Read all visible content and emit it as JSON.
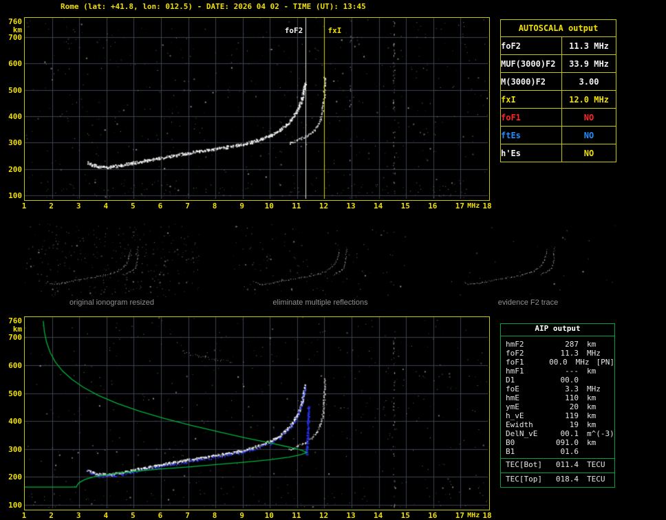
{
  "title": "Rome (lat: +41.8, lon: 012.5) - DATE: 2026 04 02 - TIME (UT): 13:45",
  "colors": {
    "yellow": "#f0e000",
    "white": "#f2f2f2",
    "red": "#ff2626",
    "blue": "#1e8fff",
    "green": "#00b43c",
    "grid": "#3d4450",
    "frame": "#c9c900",
    "caption": "#909090",
    "trace_blue": "#2a35ff"
  },
  "top_plot": {
    "y_unit": "km",
    "x_unit": "MHz",
    "y_ticks": [
      760,
      700,
      600,
      500,
      400,
      300,
      200,
      100
    ],
    "x_ticks": [
      1,
      2,
      3,
      4,
      5,
      6,
      7,
      8,
      9,
      10,
      11,
      12,
      13,
      14,
      15,
      16,
      17,
      18
    ],
    "markers": [
      {
        "label": "foF2",
        "freq": 11.3,
        "color": "white"
      },
      {
        "label": "fxI",
        "freq": 12.0,
        "color": "yellow"
      }
    ]
  },
  "bottom_plot": {
    "y_unit": "km",
    "x_unit": "MHz",
    "y_ticks": [
      760,
      700,
      600,
      500,
      400,
      300,
      200,
      100
    ],
    "x_ticks": [
      1,
      2,
      3,
      4,
      5,
      6,
      7,
      8,
      9,
      10,
      11,
      12,
      13,
      14,
      15,
      16,
      17,
      18
    ]
  },
  "autoscala": {
    "title": "AUTOSCALA output",
    "rows": [
      {
        "label": "foF2",
        "value": "11.3 MHz",
        "label_color": "white",
        "value_color": "white"
      },
      {
        "label": "MUF(3000)F2",
        "value": "33.9 MHz",
        "label_color": "white",
        "value_color": "white"
      },
      {
        "label": "M(3000)F2",
        "value": "3.00",
        "label_color": "white",
        "value_color": "white"
      },
      {
        "label": "fxI",
        "value": "12.0 MHz",
        "label_color": "yellow",
        "value_color": "yellow"
      },
      {
        "label": "foF1",
        "value": "NO",
        "label_color": "red",
        "value_color": "red"
      },
      {
        "label": "ftEs",
        "value": "NO",
        "label_color": "blue",
        "value_color": "blue"
      },
      {
        "label": "h'Es",
        "value": "NO",
        "label_color": "white",
        "value_color": "yellow"
      }
    ]
  },
  "thumbnails": [
    {
      "caption": "original ionogram resized"
    },
    {
      "caption": "eliminate multiple reflections"
    },
    {
      "caption": "evidence F2 trace"
    }
  ],
  "aip": {
    "title": "AIP output",
    "rows": [
      {
        "label": "hmF2",
        "value": "287",
        "unit": "km",
        "extra": ""
      },
      {
        "label": "foF2",
        "value": "11.3",
        "unit": "MHz",
        "extra": ""
      },
      {
        "label": "foF1",
        "value": "00.0",
        "unit": "MHz",
        "extra": "[PN]"
      },
      {
        "label": "hmF1",
        "value": "---",
        "unit": "km",
        "extra": ""
      },
      {
        "label": "D1",
        "value": "00.0",
        "unit": "",
        "extra": ""
      },
      {
        "label": "foE",
        "value": "3.3",
        "unit": "MHz",
        "extra": ""
      },
      {
        "label": "hmE",
        "value": "110",
        "unit": "km",
        "extra": ""
      },
      {
        "label": "ymE",
        "value": "20",
        "unit": "km",
        "extra": ""
      },
      {
        "label": "h_vE",
        "value": "119",
        "unit": "km",
        "extra": ""
      },
      {
        "label": "Ewidth",
        "value": "19",
        "unit": "km",
        "extra": ""
      },
      {
        "label": "DelN_vE",
        "value": "00.1",
        "unit": "m^(-3)",
        "extra": ""
      },
      {
        "label": "B0",
        "value": "091.0",
        "unit": "km",
        "extra": ""
      },
      {
        "label": "B1",
        "value": "01.6",
        "unit": "",
        "extra": ""
      }
    ],
    "tec_rows": [
      {
        "label": "TEC[Bot]",
        "value": "011.4",
        "unit": "TECU"
      },
      {
        "label": "TEC[Top]",
        "value": "018.4",
        "unit": "TECU"
      }
    ]
  },
  "chart_data": [
    {
      "type": "scatter",
      "title": "autoscaled ionogram (virtual height vs frequency)",
      "xlabel": "MHz",
      "ylabel": "km",
      "xlim": [
        1,
        18
      ],
      "ylim": [
        88,
        772
      ],
      "grid": true,
      "foF2_mhz": 11.3,
      "fxI_mhz": 12.0,
      "f2_o_trace": [
        [
          3.3,
          228
        ],
        [
          3.45,
          219
        ],
        [
          3.65,
          213
        ],
        [
          3.9,
          211
        ],
        [
          4.2,
          213
        ],
        [
          4.55,
          218
        ],
        [
          4.95,
          226
        ],
        [
          5.4,
          235
        ],
        [
          5.9,
          244
        ],
        [
          6.4,
          253
        ],
        [
          6.9,
          262
        ],
        [
          7.4,
          270
        ],
        [
          7.9,
          278
        ],
        [
          8.4,
          286
        ],
        [
          8.9,
          295
        ],
        [
          9.3,
          305
        ],
        [
          9.7,
          318
        ],
        [
          10.05,
          332
        ],
        [
          10.35,
          350
        ],
        [
          10.6,
          370
        ],
        [
          10.8,
          392
        ],
        [
          10.95,
          416
        ],
        [
          11.07,
          442
        ],
        [
          11.16,
          470
        ],
        [
          11.23,
          500
        ],
        [
          11.28,
          530
        ]
      ],
      "f2_x_trace": [
        [
          10.7,
          300
        ],
        [
          11.0,
          312
        ],
        [
          11.3,
          326
        ],
        [
          11.55,
          343
        ],
        [
          11.72,
          364
        ],
        [
          11.84,
          390
        ],
        [
          11.91,
          420
        ],
        [
          11.95,
          452
        ],
        [
          11.98,
          485
        ],
        [
          11.99,
          520
        ],
        [
          12.0,
          552
        ]
      ],
      "annotations": [
        {
          "label": "foF2",
          "x": 11.3
        },
        {
          "label": "fxI",
          "x": 12.0
        }
      ]
    },
    {
      "type": "scatter+line",
      "title": "ionogram with scaled trace and electron density profile",
      "xlabel": "MHz",
      "ylabel": "km",
      "xlim": [
        1,
        18
      ],
      "ylim": [
        88,
        772
      ],
      "grid": true,
      "hmF2_km": 287,
      "foF2_mhz": 11.3,
      "profile_topside": [
        [
          1.68,
          758
        ],
        [
          1.72,
          720
        ],
        [
          1.8,
          682
        ],
        [
          1.93,
          646
        ],
        [
          2.12,
          612
        ],
        [
          2.38,
          580
        ],
        [
          2.72,
          550
        ],
        [
          3.15,
          521
        ],
        [
          3.7,
          492
        ],
        [
          4.4,
          463
        ],
        [
          5.2,
          436
        ],
        [
          6.1,
          410
        ],
        [
          7.1,
          385
        ],
        [
          8.1,
          362
        ],
        [
          9.1,
          340
        ],
        [
          10.0,
          322
        ],
        [
          10.7,
          307
        ],
        [
          11.15,
          296
        ],
        [
          11.35,
          288
        ]
      ],
      "profile_bottomside": [
        [
          11.35,
          288
        ],
        [
          11.15,
          280
        ],
        [
          10.7,
          271
        ],
        [
          10.0,
          262
        ],
        [
          9.1,
          253
        ],
        [
          8.1,
          245
        ],
        [
          7.0,
          236
        ],
        [
          5.9,
          228
        ],
        [
          4.9,
          219
        ],
        [
          4.1,
          210
        ],
        [
          3.55,
          201
        ],
        [
          3.2,
          191
        ],
        [
          3.0,
          180
        ],
        [
          2.92,
          170
        ],
        [
          2.9,
          164
        ]
      ],
      "profile_valley_km": 164,
      "scaled_trace_asymptote": [
        [
          11.34,
          285
        ],
        [
          11.37,
          340
        ],
        [
          11.39,
          400
        ],
        [
          11.41,
          455
        ]
      ],
      "multiple_echo": [
        [
          6.8,
          648
        ],
        [
          7.4,
          632
        ],
        [
          8.0,
          620
        ],
        [
          8.6,
          612
        ]
      ]
    }
  ]
}
